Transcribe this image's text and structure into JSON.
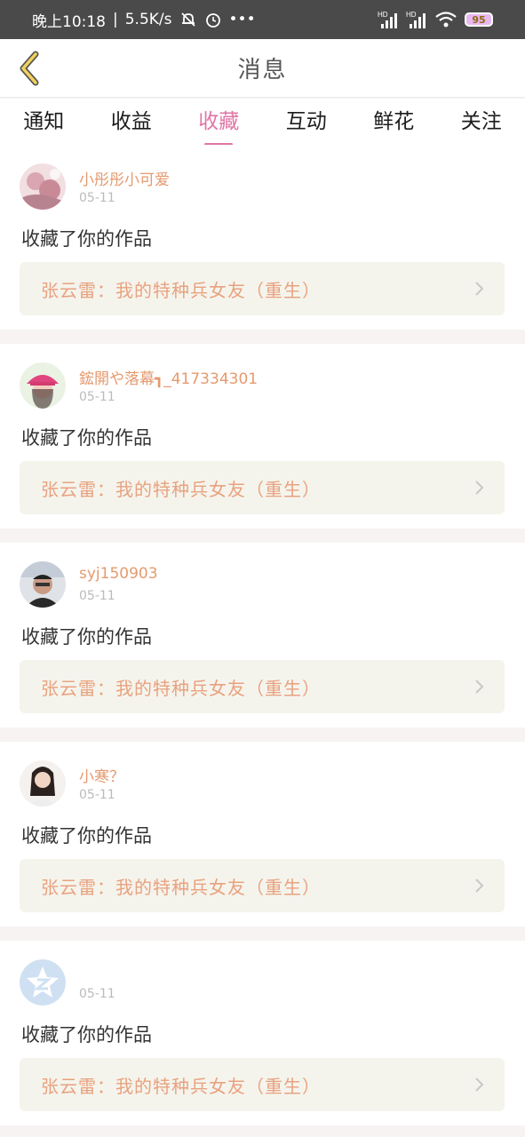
{
  "status_bar": {
    "time": "晚上10:18",
    "speed": "5.5K/s",
    "icons": [
      "mute-bell-icon",
      "alarm-icon",
      "more-dots-icon",
      "hd-signal-icon",
      "hd-signal-icon",
      "wifi-icon",
      "battery-icon"
    ],
    "hd1": "HD",
    "hd2": "HD",
    "battery": "95",
    "more": "•••"
  },
  "header": {
    "title": "消息",
    "back_icon": "back-chevron-icon",
    "accent_color": "#f2d25b"
  },
  "tabs": [
    {
      "label": "通知",
      "active": false
    },
    {
      "label": "收益",
      "active": false
    },
    {
      "label": "收藏",
      "active": true
    },
    {
      "label": "互动",
      "active": false
    },
    {
      "label": "鲜花",
      "active": false
    },
    {
      "label": "关注",
      "active": false
    }
  ],
  "colors": {
    "active_tab": "#e075a6",
    "username": "#e59a6f",
    "work_title": "#e8a280",
    "link_bg": "#f5f4ec"
  },
  "items": [
    {
      "username": "小彤彤小可爱",
      "date": "05-11",
      "action": "收藏了你的作品",
      "work": "张云雷：我的特种兵女友（重生）"
    },
    {
      "username": "鋐開や落幕┓_417334301",
      "date": "05-11",
      "action": "收藏了你的作品",
      "work": "张云雷：我的特种兵女友（重生）"
    },
    {
      "username": "syj150903",
      "date": "05-11",
      "action": "收藏了你的作品",
      "work": "张云雷：我的特种兵女友（重生）"
    },
    {
      "username": "小寒？",
      "date": "05-11",
      "action": "收藏了你的作品",
      "work": "张云雷：我的特种兵女友（重生）"
    },
    {
      "username": "",
      "date": "05-11",
      "action": "收藏了你的作品",
      "work": "张云雷：我的特种兵女友（重生）"
    }
  ]
}
